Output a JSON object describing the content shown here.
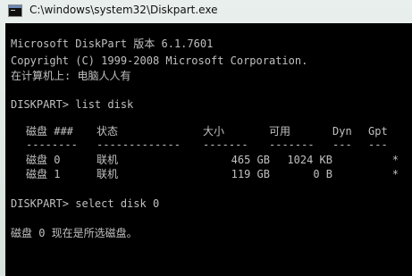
{
  "window": {
    "title": "C:\\windows\\system32\\Diskpart.exe"
  },
  "console": {
    "banner_line1": "Microsoft DiskPart 版本 6.1.7601",
    "banner_line2": "Copyright (C) 1999-2008 Microsoft Corporation.",
    "banner_line3": "在计算机上: 电脑人人有",
    "command1": "DISKPART> list disk",
    "table": {
      "headers": {
        "disk": "磁盘 ###",
        "status": "状态",
        "size": "大小",
        "free": "可用",
        "dyn": "Dyn",
        "gpt": "Gpt"
      },
      "separators": {
        "disk": "--------",
        "status": "-------------",
        "size": "-------",
        "free": "-------",
        "dyn": "---",
        "gpt": "---"
      },
      "rows": [
        {
          "disk": "磁盘 0",
          "status": "联机",
          "size": "465 GB",
          "free": "1024 KB",
          "dyn": "",
          "gpt": "*"
        },
        {
          "disk": "磁盘 1",
          "status": "联机",
          "size": "119 GB",
          "free": "0 B",
          "dyn": "",
          "gpt": "*"
        }
      ]
    },
    "command2": "DISKPART> select disk 0",
    "result": "磁盘 0 现在是所选磁盘。"
  },
  "colors": {
    "console_background": "#000000",
    "console_text": "#c0c0c0"
  },
  "icons": {
    "app": "console-app-icon"
  }
}
